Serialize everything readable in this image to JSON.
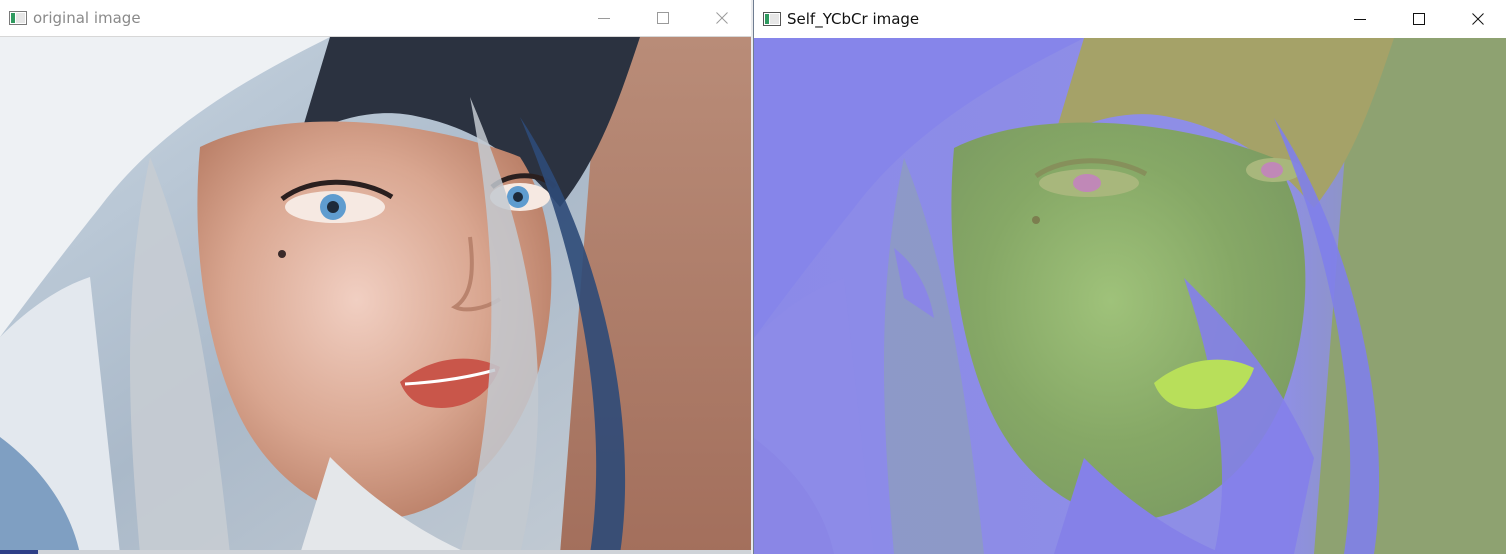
{
  "windows": {
    "original": {
      "title": "original image",
      "icon": "app-window-icon"
    },
    "ycbcr": {
      "title": "Self_YCbCr image",
      "icon": "app-window-icon"
    }
  },
  "controls": {
    "minimize": "minimize-icon",
    "maximize": "maximize-icon",
    "close": "close-icon"
  },
  "colors": {
    "original_title_text": "#8a8a8a",
    "ycbcr_title_text": "#111111",
    "ycbcr_background": "#8a86e6",
    "ycbcr_skin": "#8fb86a"
  }
}
